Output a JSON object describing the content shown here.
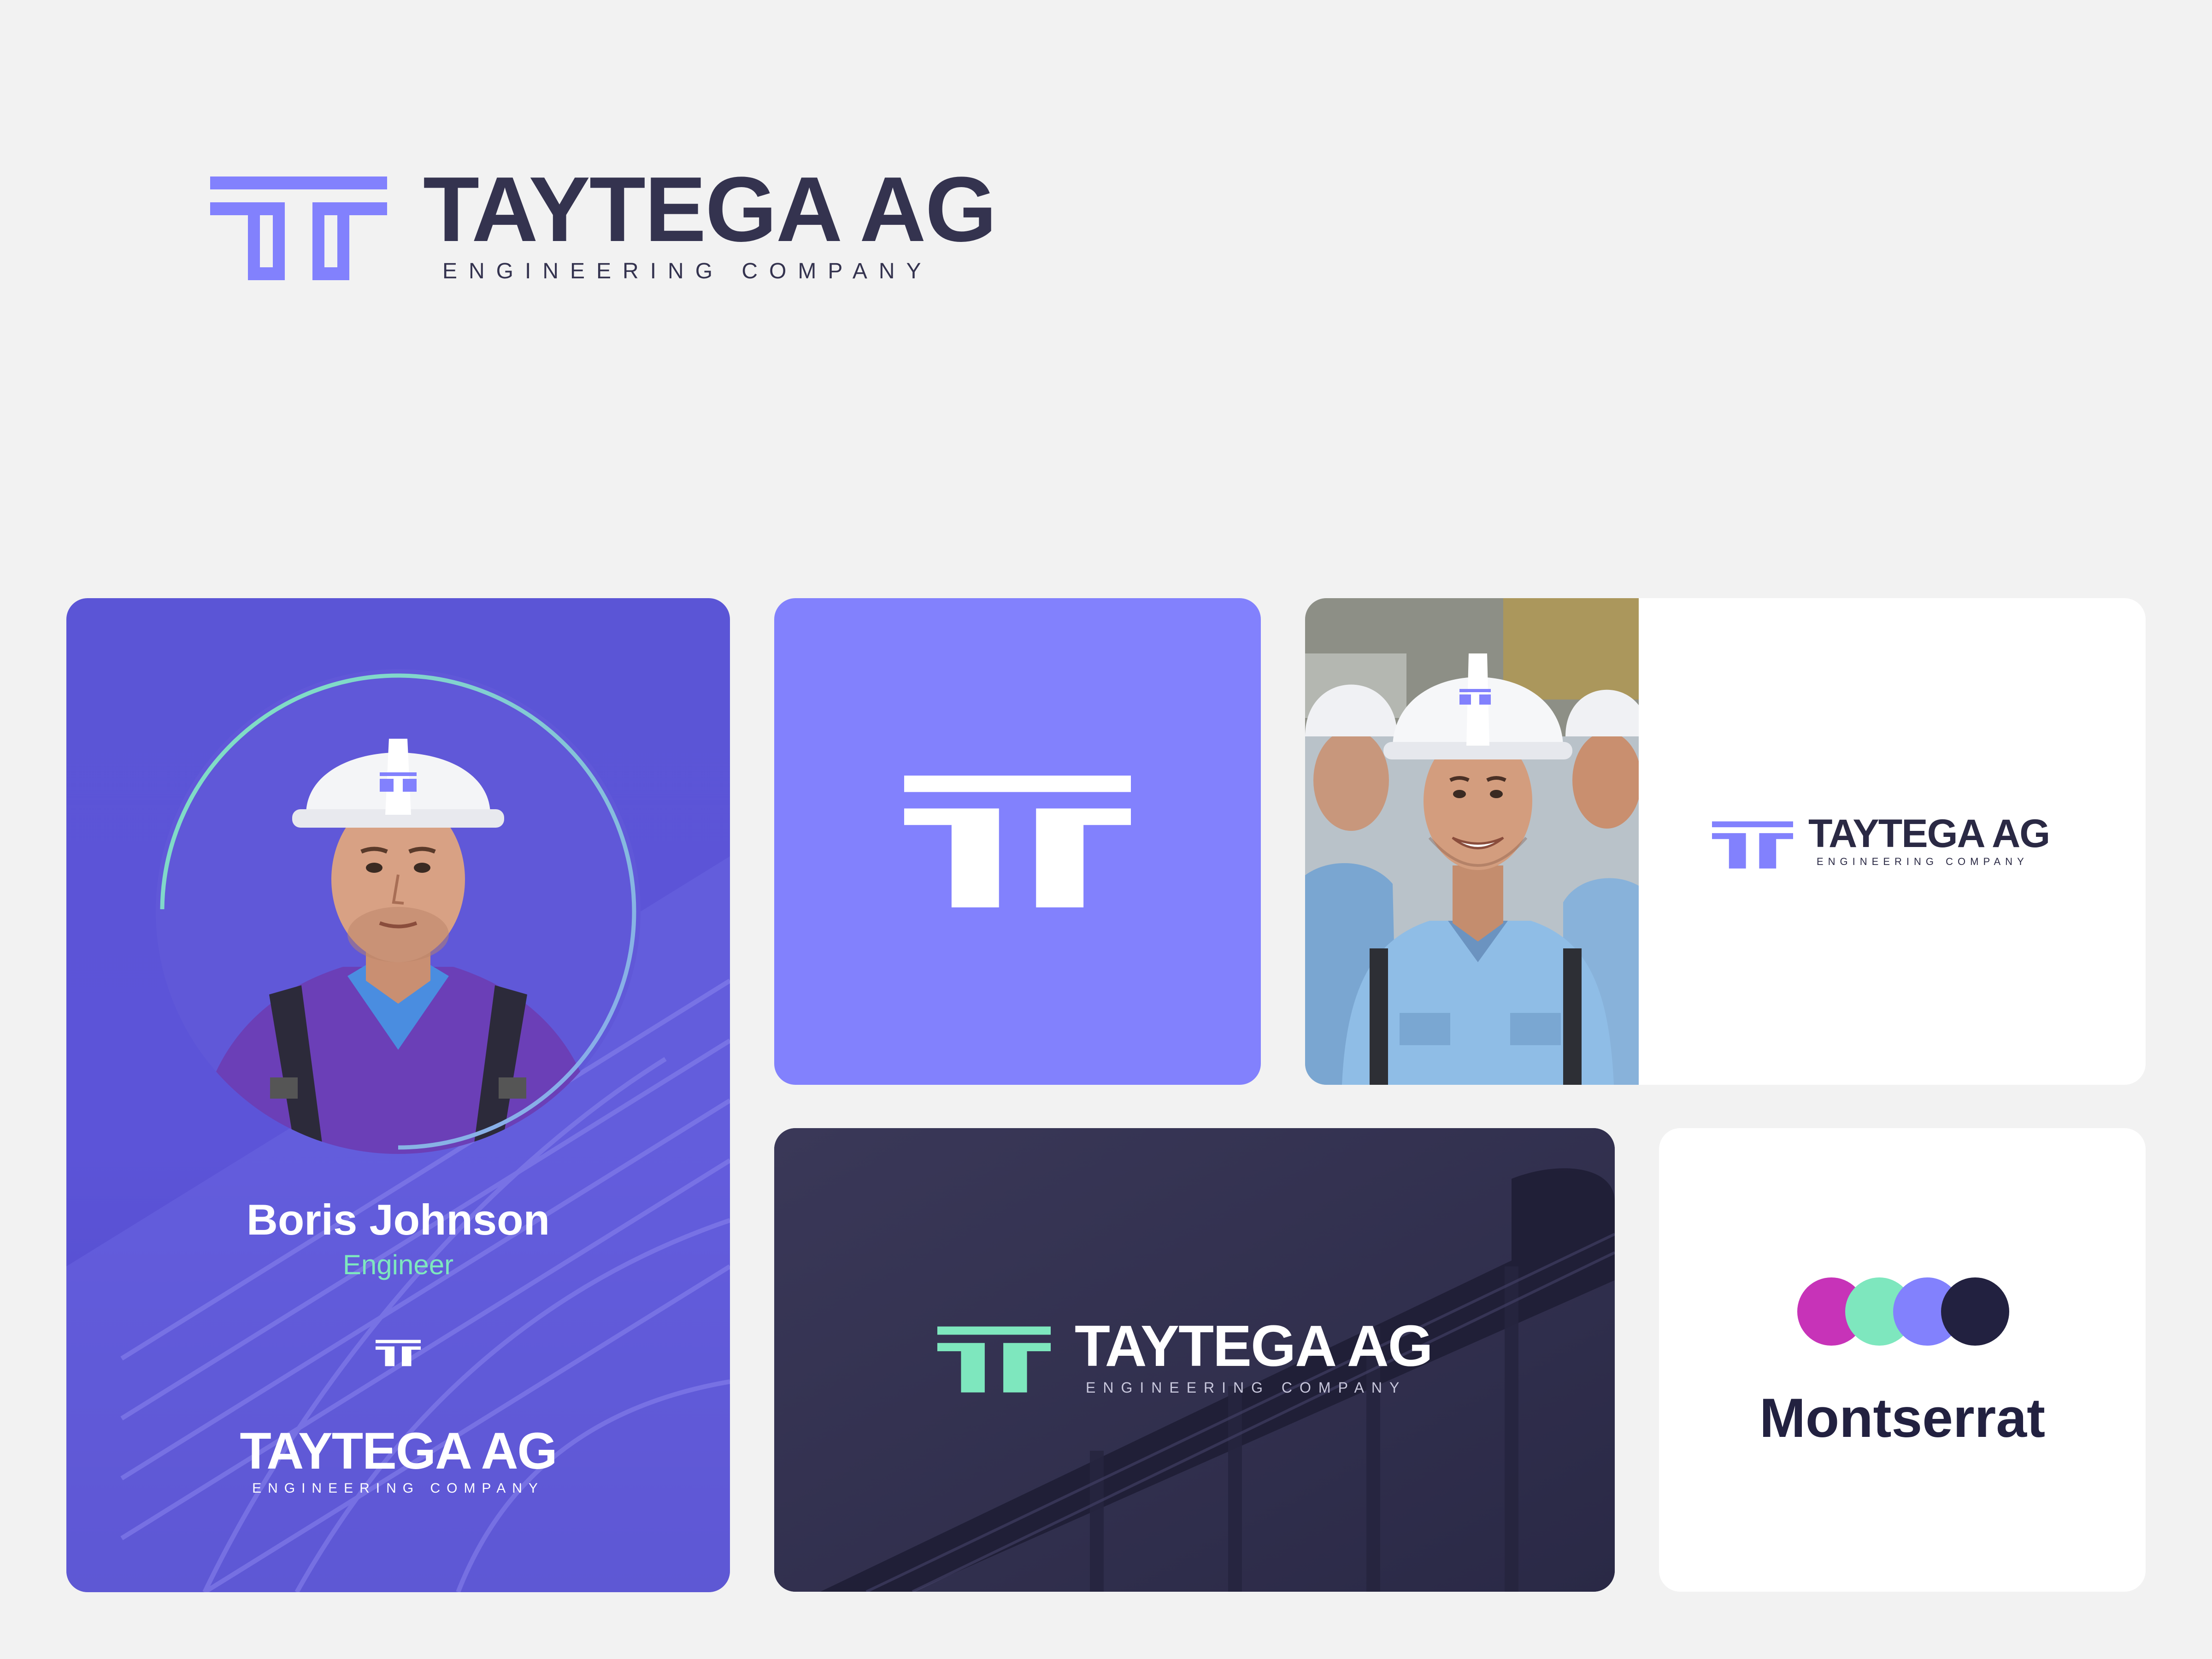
{
  "brand": {
    "name": "TAYTEGA AG",
    "tagline": "ENGINEERING COMPANY"
  },
  "badge": {
    "person_name": "Boris Johnson",
    "role": "Engineer"
  },
  "typeface": {
    "name": "Montserrat"
  },
  "colors": {
    "primary": "#8281fd",
    "badge_bg": "#5b55d6",
    "accent_green": "#7ee7be",
    "dark_navy": "#222140",
    "magenta": "#c733b8",
    "text_dark": "#34334f",
    "background": "#f2f2f2"
  },
  "palette": [
    "#c733b8",
    "#7ee7be",
    "#8281fd",
    "#222140"
  ],
  "icons": {
    "logo_mark": "tt-logo-mark-icon",
    "helmet_logo": "tt-logo-mark-icon"
  }
}
